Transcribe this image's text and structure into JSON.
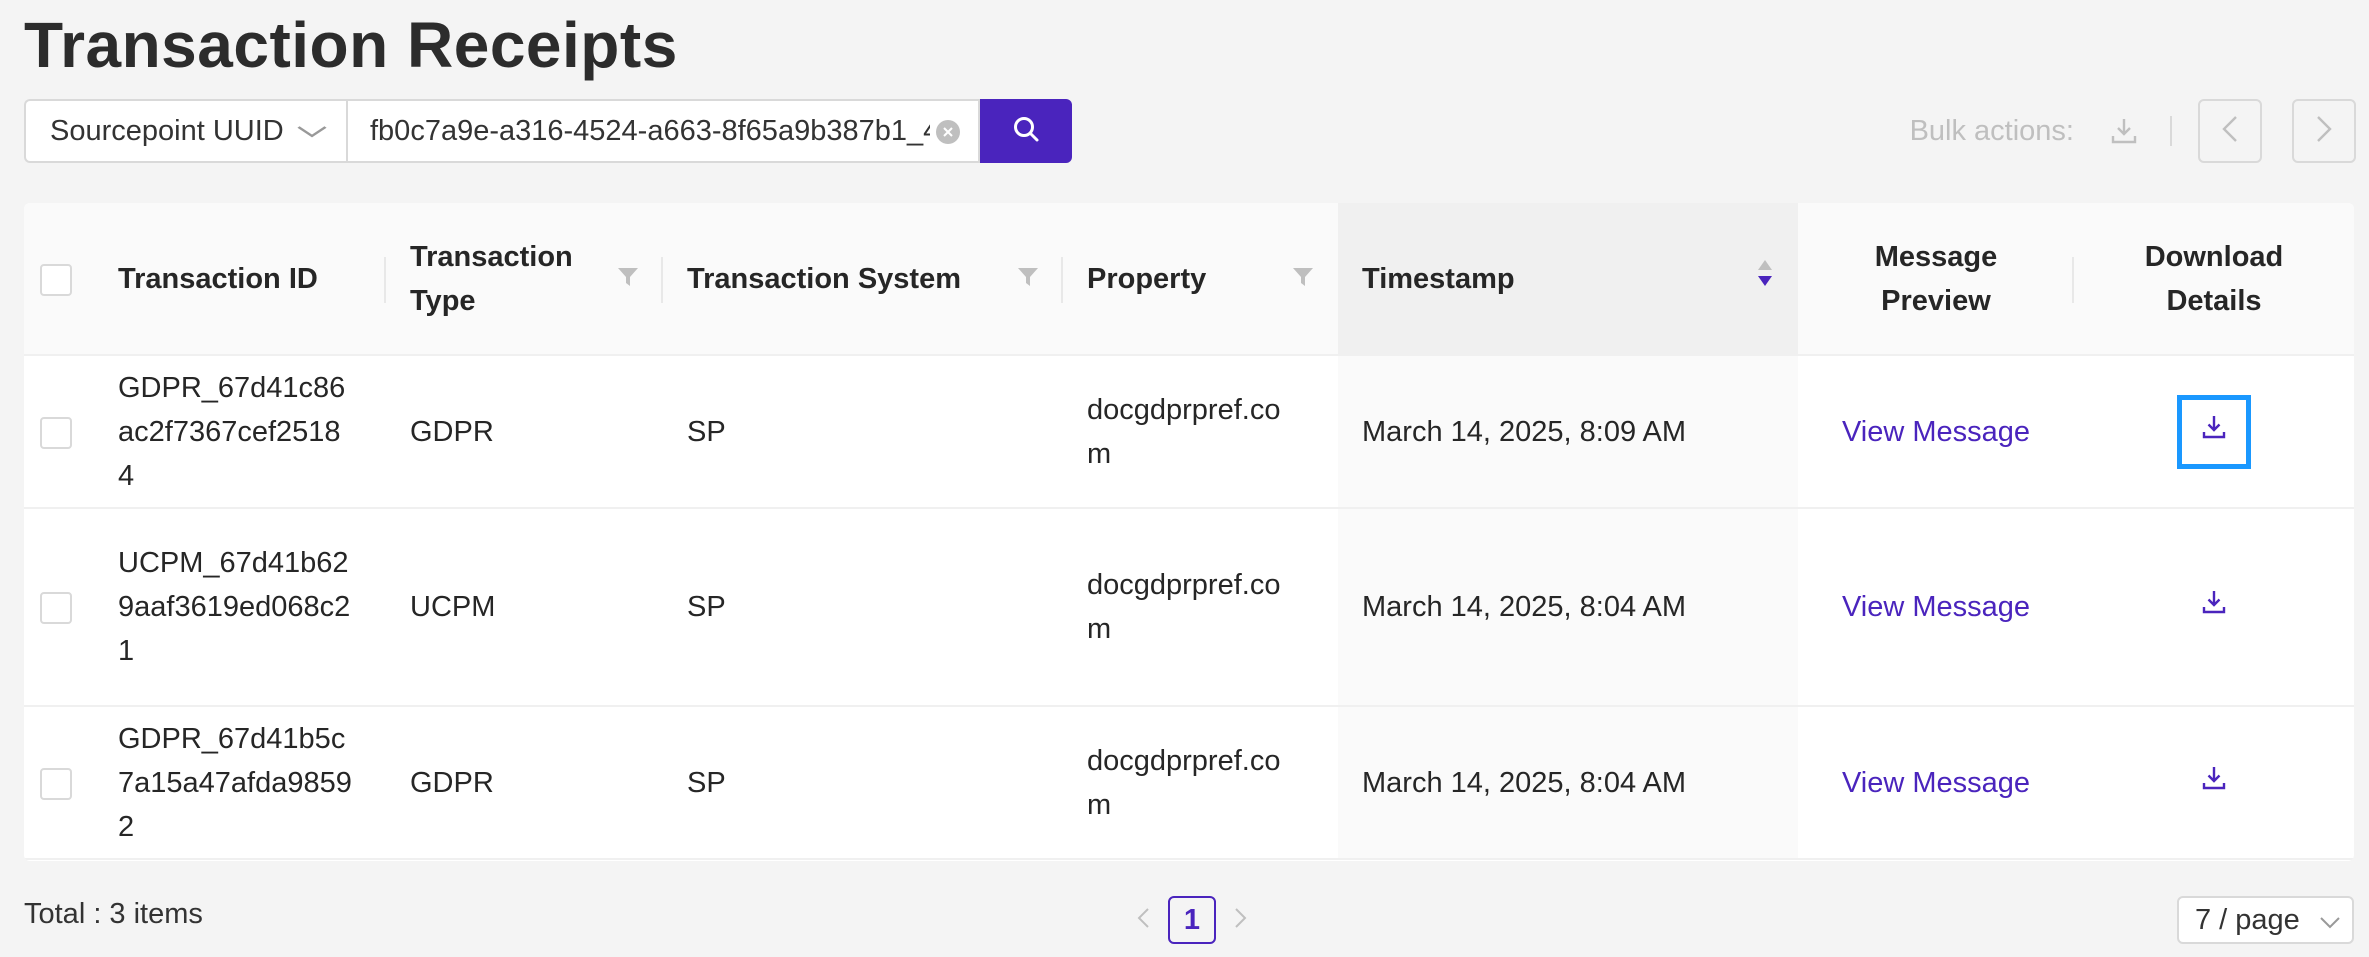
{
  "page": {
    "title": "Transaction Receipts"
  },
  "search": {
    "type_select": "Sourcepoint UUID",
    "value": "fb0c7a9e-a316-4524-a663-8f65a9b387b1_4",
    "button_icon": "search-icon"
  },
  "bulk": {
    "label": "Bulk actions:"
  },
  "table": {
    "columns": {
      "transaction_id": "Transaction ID",
      "transaction_type": "Transaction Type",
      "transaction_system": "Transaction System",
      "property": "Property",
      "timestamp": "Timestamp",
      "message_preview": "Message Preview",
      "download_details": "Download Details"
    },
    "rows": [
      {
        "id": "GDPR_67d41c86ac2f7367cef25184",
        "type": "GDPR",
        "system": "SP",
        "property": "docgdprpref.com",
        "timestamp": "March 14, 2025, 8:09 AM",
        "preview": "View Message"
      },
      {
        "id": "UCPM_67d41b629aaf3619ed068c21",
        "type": "UCPM",
        "system": "SP",
        "property": "docgdprpref.com",
        "timestamp": "March 14, 2025, 8:04 AM",
        "preview": "View Message"
      },
      {
        "id": "GDPR_67d41b5c7a15a47afda98592",
        "type": "GDPR",
        "system": "SP",
        "property": "docgdprpref.com",
        "timestamp": "March 14, 2025, 8:04 AM",
        "preview": "View Message"
      }
    ]
  },
  "footer": {
    "total": "Total : 3 items",
    "current_page": "1",
    "page_size": "7 / page"
  },
  "colors": {
    "accent": "#4a24bd",
    "focus": "#1a98ff"
  }
}
